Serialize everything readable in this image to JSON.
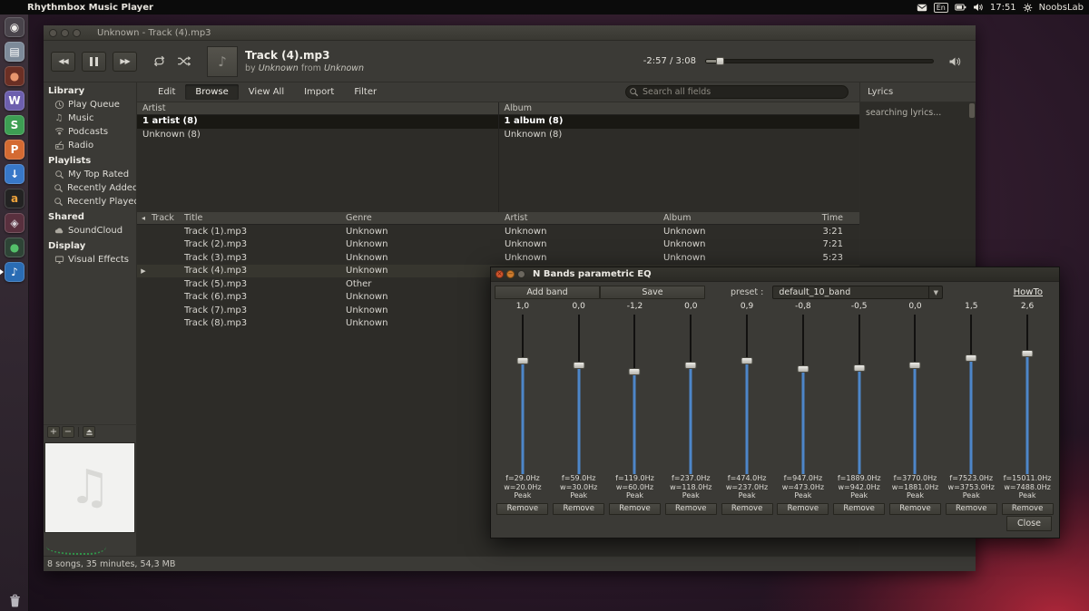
{
  "panel": {
    "app_title": "Rhythmbox Music Player",
    "keyboard_indicator": "En",
    "time": "17:51",
    "session_label": "NoobsLab"
  },
  "icons": {
    "note": "♪",
    "big_note": "♫",
    "dropdown": "▼",
    "prev": "◀◀",
    "next": "▶▶",
    "header_arrow": "◂",
    "plus": "+",
    "minus": "−"
  },
  "launcher": {
    "items": [
      {
        "name": "dash",
        "glyph": "◉",
        "bg": "#49444b",
        "fg": "#efedea"
      },
      {
        "name": "files",
        "glyph": "▤",
        "bg": "#7d8a99",
        "fg": "#ffffff"
      },
      {
        "name": "browser",
        "glyph": "●",
        "bg": "#6b2f24",
        "fg": "#e8956d"
      },
      {
        "name": "wps-writer",
        "glyph": "W",
        "bg": "#6d5fae",
        "fg": "#ffffff"
      },
      {
        "name": "wps-spreadsheets",
        "glyph": "S",
        "bg": "#3d9e53",
        "fg": "#ffffff"
      },
      {
        "name": "wps-presentation",
        "glyph": "P",
        "bg": "#d46a32",
        "fg": "#ffffff"
      },
      {
        "name": "downloader",
        "glyph": "↓",
        "bg": "#3878c8",
        "fg": "#ffffff"
      },
      {
        "name": "amazon",
        "glyph": "a",
        "bg": "#232323",
        "fg": "#f0a43c"
      },
      {
        "name": "settings",
        "glyph": "◈",
        "bg": "#59303e",
        "fg": "#d8d4da"
      },
      {
        "name": "chat",
        "glyph": "●",
        "bg": "#2e4436",
        "fg": "#54c06a"
      },
      {
        "name": "rhythmbox",
        "glyph": "♪",
        "bg": "#2a6cb4",
        "fg": "#ffffff",
        "running": true
      }
    ]
  },
  "window": {
    "title": "Unknown - Track (4).mp3",
    "player": {
      "track_title": "Track (4).mp3",
      "byline_by": "by",
      "byline_artist": "Unknown",
      "byline_from": "from",
      "byline_album": "Unknown",
      "time_display": "-2:57 / 3:08",
      "seek_fraction": 0.06
    },
    "menu": {
      "items": [
        {
          "name": "edit",
          "label": "Edit"
        },
        {
          "name": "browse",
          "label": "Browse",
          "active": true
        },
        {
          "name": "view-all",
          "label": "View All"
        },
        {
          "name": "import",
          "label": "Import"
        },
        {
          "name": "filter",
          "label": "Filter"
        }
      ],
      "search_placeholder": "Search all fields"
    },
    "sidebar": {
      "sections": [
        {
          "title": "Library",
          "items": [
            {
              "label": "Play Queue"
            },
            {
              "label": "Music"
            },
            {
              "label": "Podcasts"
            },
            {
              "label": "Radio"
            }
          ]
        },
        {
          "title": "Playlists",
          "items": [
            {
              "label": "My Top Rated"
            },
            {
              "label": "Recently Added"
            },
            {
              "label": "Recently Played"
            }
          ]
        },
        {
          "title": "Shared",
          "items": [
            {
              "label": "SoundCloud"
            }
          ]
        },
        {
          "title": "Display",
          "items": [
            {
              "label": "Visual Effects"
            }
          ]
        }
      ]
    },
    "browser": {
      "artist_header": "Artist",
      "album_header": "Album",
      "artist_items": [
        {
          "name": "all-artists",
          "label": "1 artist (8)",
          "selected": true
        },
        {
          "name": "unknown-artist",
          "label": "Unknown (8)"
        }
      ],
      "album_items": [
        {
          "name": "all-albums",
          "label": "1 album (8)",
          "selected": true
        },
        {
          "name": "unknown-album",
          "label": "Unknown (8)"
        }
      ]
    },
    "tracklist": {
      "columns": {
        "play": "◂",
        "track": "Track",
        "title": "Title",
        "genre": "Genre",
        "artist": "Artist",
        "album": "Album",
        "time": "Time"
      },
      "rows": [
        {
          "indicator": "",
          "num": "",
          "title": "Track (1).mp3",
          "genre": "Unknown",
          "artist": "Unknown",
          "album": "Unknown",
          "time": "3:21"
        },
        {
          "indicator": "",
          "num": "",
          "title": "Track (2).mp3",
          "genre": "Unknown",
          "artist": "Unknown",
          "album": "Unknown",
          "time": "7:21"
        },
        {
          "indicator": "",
          "num": "",
          "title": "Track (3).mp3",
          "genre": "Unknown",
          "artist": "Unknown",
          "album": "Unknown",
          "time": "5:23"
        },
        {
          "indicator": "▶",
          "num": "",
          "title": "Track (4).mp3",
          "genre": "Unknown",
          "artist": "",
          "album": "",
          "time": "",
          "playing": true
        },
        {
          "indicator": "",
          "num": "",
          "title": "Track (5).mp3",
          "genre": "Other",
          "artist": "",
          "album": "",
          "time": ""
        },
        {
          "indicator": "",
          "num": "",
          "title": "Track (6).mp3",
          "genre": "Unknown",
          "artist": "",
          "album": "",
          "time": ""
        },
        {
          "indicator": "",
          "num": "",
          "title": "Track (7).mp3",
          "genre": "Unknown",
          "artist": "",
          "album": "",
          "time": ""
        },
        {
          "indicator": "",
          "num": "",
          "title": "Track (8).mp3",
          "genre": "Unknown",
          "artist": "",
          "album": "",
          "time": ""
        }
      ]
    },
    "lyrics": {
      "header": "Lyrics",
      "status": "searching lyrics..."
    },
    "status_bar": "8 songs, 35 minutes, 54,3 MB"
  },
  "eq_dialog": {
    "title": "N Bands parametric EQ",
    "add_band_label": "Add band",
    "save_label": "Save",
    "preset_label": "preset :",
    "preset_value": "default_10_band",
    "howto_label": "HowTo",
    "close_label": "Close",
    "bands": [
      {
        "gain": "1,0",
        "freq": "f=29.0Hz",
        "width": "w=20.0Hz",
        "shape": "Peak",
        "remove": "Remove",
        "handle_pct": 0.29
      },
      {
        "gain": "0,0",
        "freq": "f=59.0Hz",
        "width": "w=30.0Hz",
        "shape": "Peak",
        "remove": "Remove",
        "handle_pct": 0.32
      },
      {
        "gain": "-1,2",
        "freq": "f=119.0Hz",
        "width": "w=60.0Hz",
        "shape": "Peak",
        "remove": "Remove",
        "handle_pct": 0.36
      },
      {
        "gain": "0,0",
        "freq": "f=237.0Hz",
        "width": "w=118.0Hz",
        "shape": "Peak",
        "remove": "Remove",
        "handle_pct": 0.32
      },
      {
        "gain": "0,9",
        "freq": "f=474.0Hz",
        "width": "w=237.0Hz",
        "shape": "Peak",
        "remove": "Remove",
        "handle_pct": 0.29
      },
      {
        "gain": "-0,8",
        "freq": "f=947.0Hz",
        "width": "w=473.0Hz",
        "shape": "Peak",
        "remove": "Remove",
        "handle_pct": 0.34
      },
      {
        "gain": "-0,5",
        "freq": "f=1889.0Hz",
        "width": "w=942.0Hz",
        "shape": "Peak",
        "remove": "Remove",
        "handle_pct": 0.335
      },
      {
        "gain": "0,0",
        "freq": "f=3770.0Hz",
        "width": "w=1881.0Hz",
        "shape": "Peak",
        "remove": "Remove",
        "handle_pct": 0.32
      },
      {
        "gain": "1,5",
        "freq": "f=7523.0Hz",
        "width": "w=3753.0Hz",
        "shape": "Peak",
        "remove": "Remove",
        "handle_pct": 0.275
      },
      {
        "gain": "2,6",
        "freq": "f=15011.0Hz",
        "width": "w=7488.0Hz",
        "shape": "Peak",
        "remove": "Remove",
        "handle_pct": 0.245
      }
    ]
  }
}
